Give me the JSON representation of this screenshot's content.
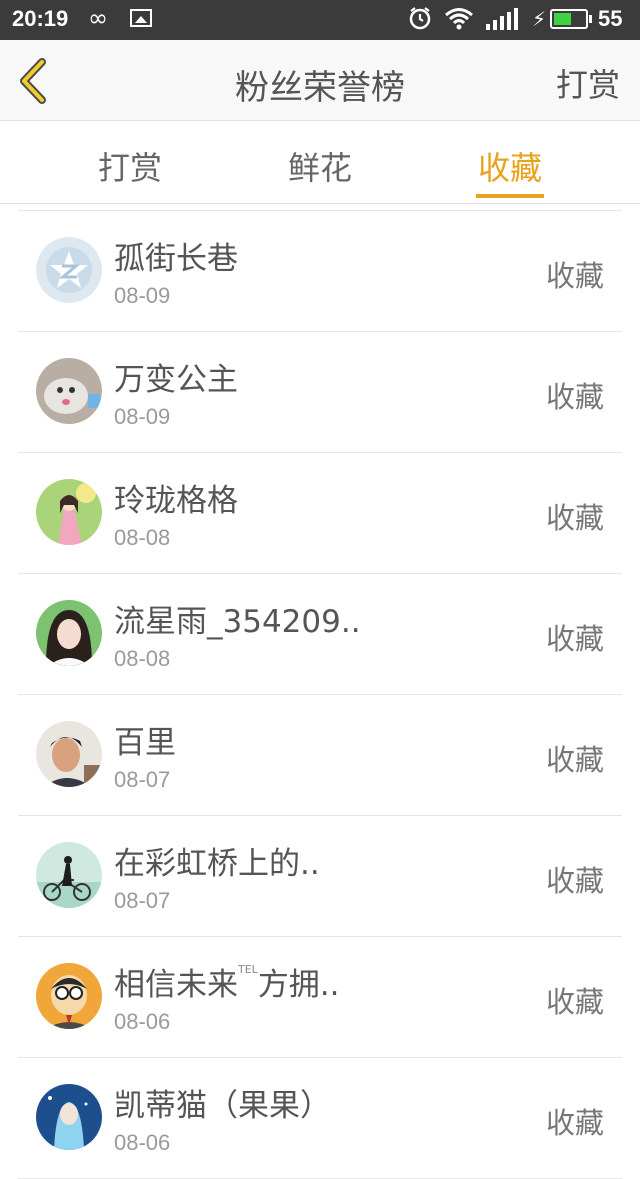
{
  "status_bar": {
    "time": "20:19",
    "infinity": "∞",
    "battery_level": "55",
    "battery_fraction": 0.55,
    "icons": [
      "infinity-icon",
      "image-icon",
      "alarm-icon",
      "wifi-icon",
      "signal-icon",
      "charging-icon",
      "battery-icon"
    ]
  },
  "header": {
    "title": "粉丝荣誉榜",
    "action": "打赏",
    "back_icon": "chevron-left-icon"
  },
  "tabs": [
    {
      "label": "打赏",
      "active": false
    },
    {
      "label": "鲜花",
      "active": false
    },
    {
      "label": "收藏",
      "active": true
    }
  ],
  "colors": {
    "accent": "#e9a21d",
    "statusbar": "#3b3b3b",
    "text": "#555555",
    "subtext": "#9a9a9a"
  },
  "list": [
    {
      "name": "孤街长巷",
      "date": "08-09",
      "action": "收藏",
      "avatar": "default-avatar"
    },
    {
      "name": "万变公主",
      "date": "08-09",
      "action": "收藏",
      "avatar": "dog-avatar"
    },
    {
      "name": "玲珑格格",
      "date": "08-08",
      "action": "收藏",
      "avatar": "anime-girl-avatar"
    },
    {
      "name": "流星雨_354209..",
      "date": "08-08",
      "action": "收藏",
      "avatar": "woman-avatar"
    },
    {
      "name": "百里",
      "date": "08-07",
      "action": "收藏",
      "avatar": "man-avatar"
    },
    {
      "name": "在彩虹桥上的..",
      "date": "08-07",
      "action": "收藏",
      "avatar": "bicycle-avatar"
    },
    {
      "name_before": "相信未来",
      "name_tel": "TEL",
      "name_after": "方拥..",
      "date": "08-06",
      "action": "收藏",
      "avatar": "cartoon-avatar"
    },
    {
      "name": "凯蒂猫（果果）",
      "date": "08-06",
      "action": "收藏",
      "avatar": "anime-avatar"
    }
  ]
}
